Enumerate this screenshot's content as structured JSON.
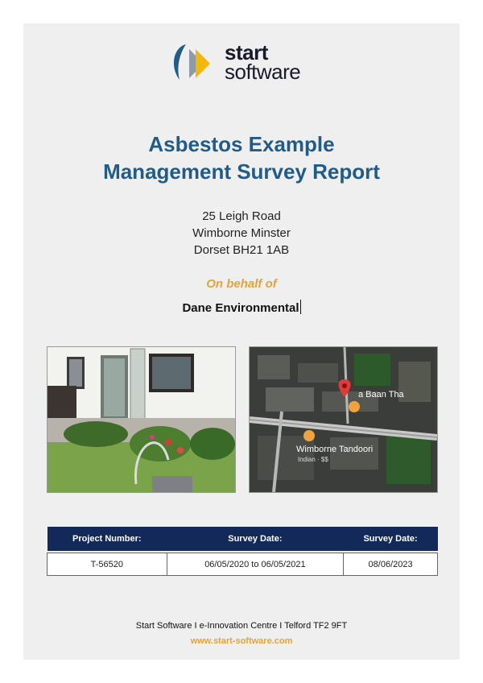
{
  "logo": {
    "line1": "start",
    "line2": "software",
    "colors": [
      "#1f5c8b",
      "#f5b800",
      "#8a9bb0"
    ]
  },
  "title": {
    "line1": "Asbestos Example",
    "line2": "Management Survey Report"
  },
  "address": {
    "line1": "25 Leigh Road",
    "line2": "Wimborne Minster",
    "line3": "Dorset BH21 1AB"
  },
  "on_behalf_label": "On behalf of",
  "client_name": "Dane Environmental",
  "map": {
    "label1": "a Baan Tha",
    "label2": "Wimborne Tandoori",
    "label3": "Indian · $$"
  },
  "table": {
    "headers": [
      "Project Number:",
      "Survey Date:",
      "Survey Date:"
    ],
    "row": [
      "T-56520",
      "06/05/2020 to 06/05/2021",
      "08/06/2023"
    ]
  },
  "footer": {
    "address": "Start Software I e-Innovation Centre I Telford TF2 9FT",
    "website": "www.start-software.com"
  },
  "colors": {
    "title": "#1f5c8b",
    "accent": "#e8a23b",
    "table_header": "#12295a"
  }
}
